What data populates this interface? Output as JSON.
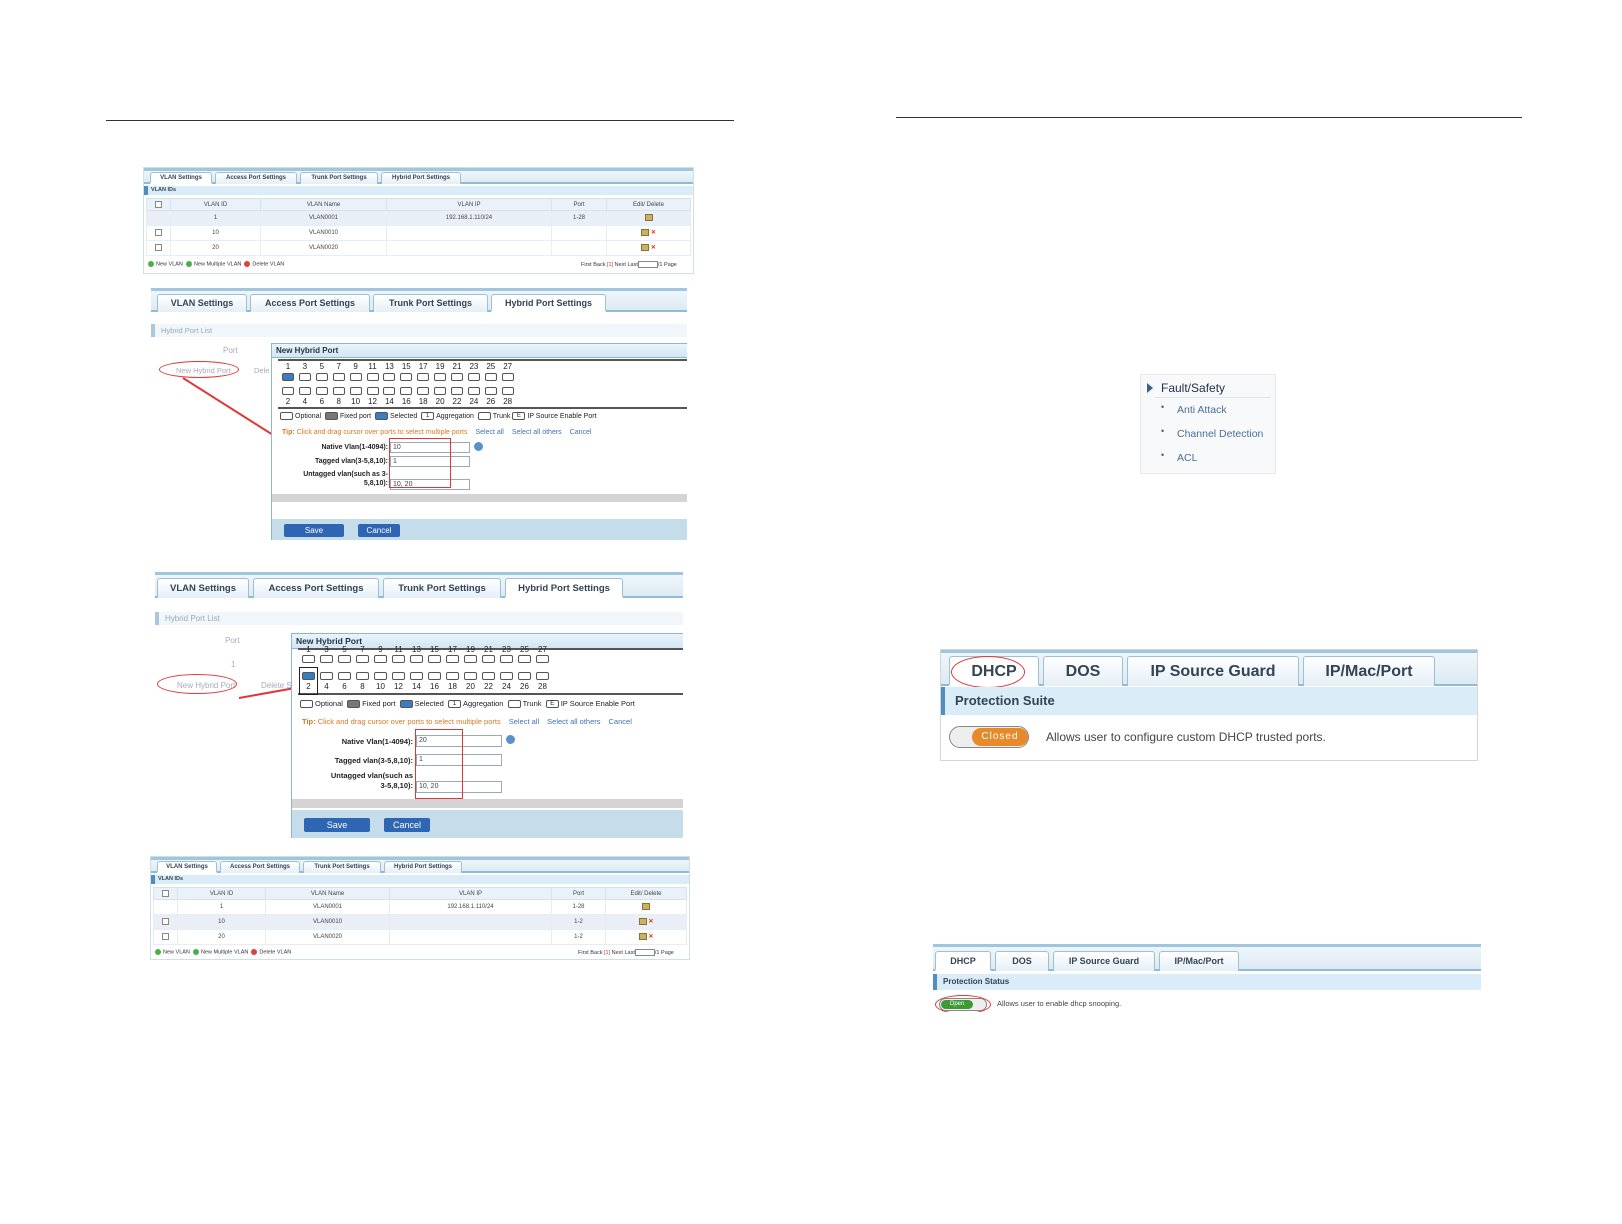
{
  "tabs": [
    "VLAN Settings",
    "Access Port Settings",
    "Trunk Port Settings",
    "Hybrid Port Settings"
  ],
  "vlan_table": {
    "section": "VLAN IDs",
    "headers": [
      "VLAN ID",
      "VLAN Name",
      "VLAN IP",
      "Port",
      "Edit/ Delete"
    ],
    "rows_before": [
      {
        "id": "1",
        "name": "VLAN0001",
        "ip": "192.168.1.110/24",
        "port": "1-28"
      },
      {
        "id": "10",
        "name": "VLAN0010",
        "ip": "",
        "port": ""
      },
      {
        "id": "20",
        "name": "VLAN0020",
        "ip": "",
        "port": ""
      }
    ],
    "rows_after": [
      {
        "id": "1",
        "name": "VLAN0001",
        "ip": "192.168.1.110/24",
        "port": "1-28"
      },
      {
        "id": "10",
        "name": "VLAN0010",
        "ip": "",
        "port": "1-2"
      },
      {
        "id": "20",
        "name": "VLAN0020",
        "ip": "",
        "port": "1-2"
      }
    ],
    "actions": [
      "New VLAN",
      "New Multiple VLAN",
      "Delete VLAN"
    ],
    "pager": {
      "first": "First",
      "back": "Back",
      "current": "[1]",
      "next": "Next",
      "last": "Last",
      "total": "/1 Page"
    }
  },
  "hybrid": {
    "list_title": "Hybrid Port List",
    "port_col": "Port",
    "new_link": "New Hybrid Port",
    "delete_link_a": "Dele",
    "delete_link_b": "Delete S",
    "row_port": "1",
    "dialog_title": "New Hybrid Port",
    "ports_top": [
      "1",
      "3",
      "5",
      "7",
      "9",
      "11",
      "13",
      "15",
      "17",
      "19",
      "21",
      "23",
      "25",
      "27"
    ],
    "ports_bottom": [
      "2",
      "4",
      "6",
      "8",
      "10",
      "12",
      "14",
      "16",
      "18",
      "20",
      "22",
      "24",
      "26",
      "28"
    ],
    "legend": [
      "Optional",
      "Fixed port",
      "Selected",
      "Aggregation",
      "Trunk",
      "IP Source Enable Port"
    ],
    "legend_marks": {
      "aggregation": "1",
      "ipsource": "E"
    },
    "tip_label": "Tip:",
    "tip": "Click and drag cursor over ports to select multiple ports",
    "tip_links": [
      "Select all",
      "Select all others",
      "Cancel"
    ],
    "form1": {
      "native_label": "Native Vlan(1-4094):",
      "native": "10",
      "tagged_label": "Tagged vlan(3-5,8,10):",
      "tagged": "1",
      "untagged_label1": "Untagged vlan(such as 3-",
      "untagged_label2": "5,8,10):",
      "untagged": "10, 20"
    },
    "form2": {
      "native_label": "Native Vlan(1-4094):",
      "native": "20",
      "tagged_label": "Tagged vlan(3-5,8,10):",
      "tagged": "1",
      "untagged_label1": "Untagged vlan(such as",
      "untagged_label2": "3-5,8,10):",
      "untagged": "10, 20"
    },
    "save": "Save",
    "cancel": "Cancel"
  },
  "menu": {
    "title": "Fault/Safety",
    "items": [
      "Anti Attack",
      "Channel Detection",
      "ACL"
    ]
  },
  "security_tabs": [
    "DHCP",
    "DOS",
    "IP Source Guard",
    "IP/Mac/Port"
  ],
  "dhcp_suite": {
    "section": "Protection Suite",
    "toggle": "Closed",
    "desc": "Allows user to configure custom DHCP trusted ports."
  },
  "dhcp_status": {
    "section": "Protection Status",
    "toggle": "Open",
    "desc": "Allows user to enable dhcp snooping."
  },
  "colors": {
    "tab_border": "#8ebbd6",
    "header_bar": "#d9ecf7",
    "selected_port": "#3a7dc1",
    "annotation": "#e23636",
    "toggle_closed": "#e88a2a",
    "toggle_open": "#3e9a34",
    "button": "#2f66b3"
  }
}
